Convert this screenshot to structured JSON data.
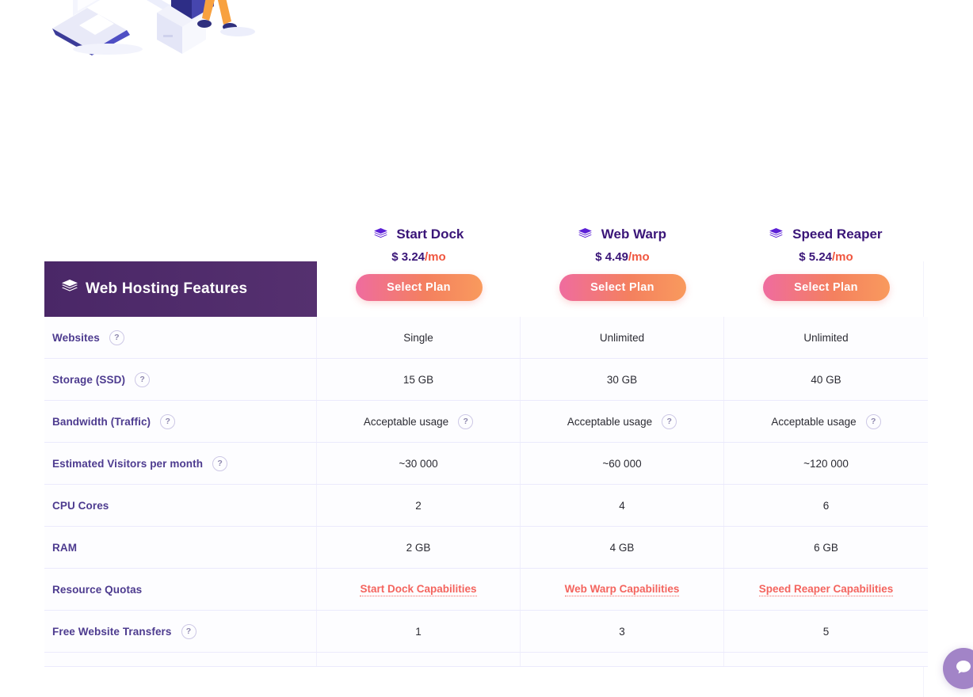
{
  "illustration": {
    "alt": "isometric-hosting-illustration"
  },
  "table": {
    "features_header": {
      "label": "Web Hosting Features",
      "icon": "stack-icon",
      "background": "#4a2767"
    },
    "plans": [
      {
        "name": "Start Dock",
        "icon": "stack-icon",
        "price_amount": "$ 3.24",
        "price_period": "/mo",
        "cta": "Select Plan"
      },
      {
        "name": "Web Warp",
        "icon": "stack-icon",
        "price_amount": "$ 4.49",
        "price_period": "/mo",
        "cta": "Select Plan"
      },
      {
        "name": "Speed Reaper",
        "icon": "stack-icon",
        "price_amount": "$ 5.24",
        "price_period": "/mo",
        "cta": "Select Plan"
      }
    ],
    "rows": [
      {
        "label": "Websites",
        "help": "?",
        "has_help": true,
        "values": [
          "Single",
          "Unlimited",
          "Unlimited"
        ],
        "value_help": false,
        "type": "text"
      },
      {
        "label": "Storage (SSD)",
        "help": "?",
        "has_help": true,
        "values": [
          "15 GB",
          "30 GB",
          "40 GB"
        ],
        "value_help": false,
        "type": "text"
      },
      {
        "label": "Bandwidth (Traffic)",
        "help": "?",
        "has_help": true,
        "values": [
          "Acceptable usage",
          "Acceptable usage",
          "Acceptable usage"
        ],
        "value_help": true,
        "value_help_label": "?",
        "type": "text"
      },
      {
        "label": "Estimated Visitors per month",
        "help": "?",
        "has_help": true,
        "values": [
          "~30 000",
          "~60 000",
          "~120 000"
        ],
        "value_help": false,
        "type": "text"
      },
      {
        "label": "CPU Cores",
        "help": "",
        "has_help": false,
        "values": [
          "2",
          "4",
          "6"
        ],
        "value_help": false,
        "type": "text"
      },
      {
        "label": "RAM",
        "help": "",
        "has_help": false,
        "values": [
          "2 GB",
          "4 GB",
          "6 GB"
        ],
        "value_help": false,
        "type": "text"
      },
      {
        "label": "Resource Quotas",
        "help": "",
        "has_help": false,
        "values": [
          "Start Dock Capabilities",
          "Web Warp Capabilities",
          "Speed Reaper Capabilities"
        ],
        "value_help": false,
        "type": "link"
      },
      {
        "label": "Free Website Transfers",
        "help": "?",
        "has_help": true,
        "values": [
          "1",
          "3",
          "5"
        ],
        "value_help": false,
        "type": "text"
      }
    ]
  },
  "chat_widget": {
    "icon": "chat-bubble-icon"
  },
  "colors": {
    "header_purple": "#4a2767",
    "plan_name": "#3a1578",
    "feature_label": "#4d3b8f",
    "price_period": "#f0563f",
    "link": "#f4645e",
    "cta_gradient_start": "#ef6c9f",
    "cta_gradient_end": "#f99a5d",
    "row_border": "#ebeafc",
    "chat_widget": "#a284c7"
  }
}
